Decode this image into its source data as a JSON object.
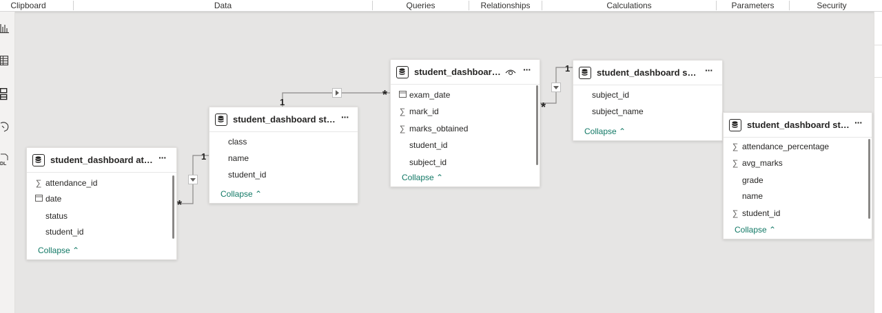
{
  "ribbon": {
    "groups": [
      "Clipboard",
      "Data",
      "Queries",
      "Relationships",
      "Calculations",
      "Parameters",
      "Security"
    ]
  },
  "rail": {
    "icons": [
      "report-view-icon",
      "table-view-icon",
      "model-view-icon",
      "dax-query-view-icon",
      "tmdl-view-icon"
    ],
    "tmdl_label": "DL"
  },
  "tables": [
    {
      "title": "student_dashboard atte...",
      "fields": [
        {
          "icon": "sigma",
          "name": "attendance_id"
        },
        {
          "icon": "calendar",
          "name": "date"
        },
        {
          "icon": "none",
          "name": "status"
        },
        {
          "icon": "none",
          "name": "student_id"
        }
      ],
      "collapse": "Collapse"
    },
    {
      "title": "student_dashboard stu...",
      "fields": [
        {
          "icon": "none",
          "name": "class"
        },
        {
          "icon": "none",
          "name": "name"
        },
        {
          "icon": "none",
          "name": "student_id"
        }
      ],
      "collapse": "Collapse"
    },
    {
      "title": "student_dashboard...",
      "fields": [
        {
          "icon": "calendar",
          "name": "exam_date"
        },
        {
          "icon": "sigma",
          "name": "mark_id"
        },
        {
          "icon": "sigma",
          "name": "marks_obtained"
        },
        {
          "icon": "none",
          "name": "student_id"
        },
        {
          "icon": "none",
          "name": "subject_id"
        }
      ],
      "collapse": "Collapse"
    },
    {
      "title": "student_dashboard subj...",
      "fields": [
        {
          "icon": "none",
          "name": "subject_id"
        },
        {
          "icon": "none",
          "name": "subject_name"
        }
      ],
      "collapse": "Collapse"
    },
    {
      "title": "student_dashboard stu...",
      "fields": [
        {
          "icon": "sigma",
          "name": "attendance_percentage"
        },
        {
          "icon": "sigma",
          "name": "avg_marks"
        },
        {
          "icon": "none",
          "name": "grade"
        },
        {
          "icon": "none",
          "name": "name"
        },
        {
          "icon": "sigma",
          "name": "student_id"
        }
      ],
      "collapse": "Collapse"
    }
  ],
  "relationships": [
    {
      "from": "student_dashboard atte...",
      "to": "student_dashboard stu...",
      "many": "*",
      "one": "1"
    },
    {
      "from": "student_dashboard...",
      "to": "student_dashboard stu...",
      "many": "*",
      "one": "1"
    },
    {
      "from": "student_dashboard...",
      "to": "student_dashboard subj...",
      "many": "*",
      "one": "1"
    }
  ],
  "glyphs": {
    "sigma": "∑",
    "more": "···",
    "collapse_chevron": "^"
  },
  "colors": {
    "canvas": "#e6e5e4",
    "collapse_link": "#117865",
    "line": "#8a8886"
  }
}
